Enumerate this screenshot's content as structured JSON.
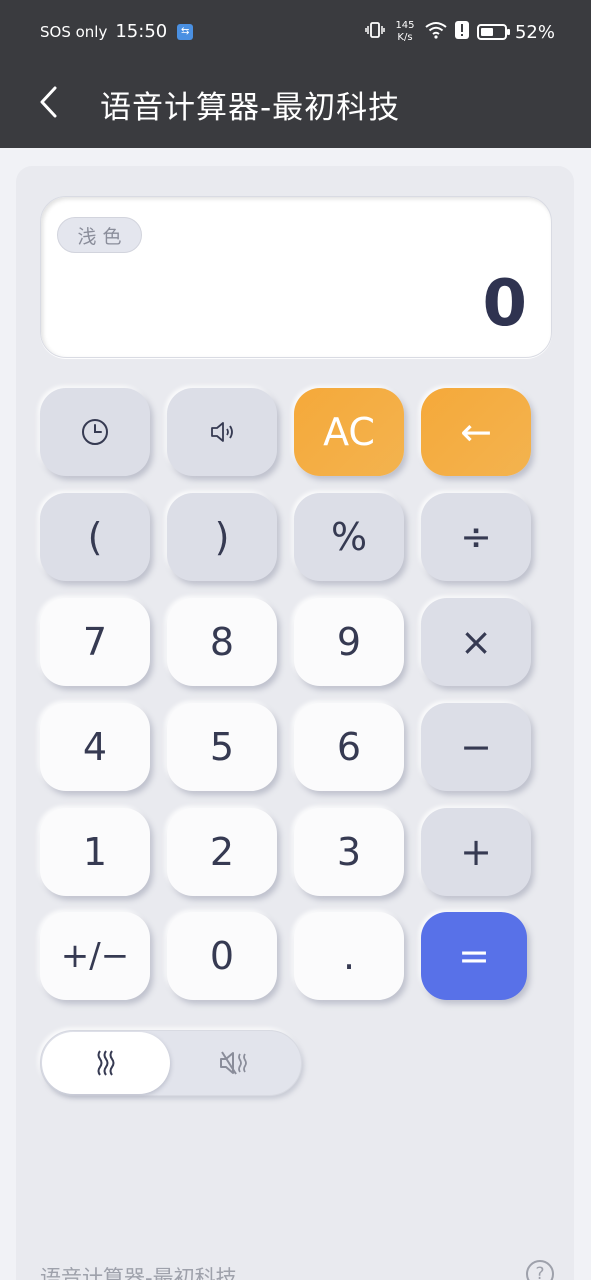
{
  "status_bar": {
    "carrier": "SOS only",
    "time": "15:50",
    "speed_value": "145",
    "speed_unit": "K/s",
    "battery": "52%",
    "battery_level": 0.52
  },
  "header": {
    "title": "语音计算器-最初科技",
    "back_icon": "chevron-left-icon"
  },
  "display": {
    "theme_label": "浅色",
    "value": "0"
  },
  "keys": [
    {
      "name": "history-key",
      "label": "",
      "icon": "clock-icon",
      "style": "gray"
    },
    {
      "name": "speaker-key",
      "label": "",
      "icon": "speaker-icon",
      "style": "gray"
    },
    {
      "name": "all-clear-key",
      "label": "AC",
      "style": "orange"
    },
    {
      "name": "backspace-key",
      "label": "←",
      "style": "orange"
    },
    {
      "name": "open-paren-key",
      "label": "(",
      "style": "gray"
    },
    {
      "name": "close-paren-key",
      "label": ")",
      "style": "gray"
    },
    {
      "name": "percent-key",
      "label": "%",
      "style": "gray"
    },
    {
      "name": "divide-key",
      "label": "÷",
      "style": "gray"
    },
    {
      "name": "digit-7-key",
      "label": "7",
      "style": "white"
    },
    {
      "name": "digit-8-key",
      "label": "8",
      "style": "white"
    },
    {
      "name": "digit-9-key",
      "label": "9",
      "style": "white"
    },
    {
      "name": "multiply-key",
      "label": "×",
      "style": "gray"
    },
    {
      "name": "digit-4-key",
      "label": "4",
      "style": "white"
    },
    {
      "name": "digit-5-key",
      "label": "5",
      "style": "white"
    },
    {
      "name": "digit-6-key",
      "label": "6",
      "style": "white"
    },
    {
      "name": "minus-key",
      "label": "−",
      "style": "gray"
    },
    {
      "name": "digit-1-key",
      "label": "1",
      "style": "white"
    },
    {
      "name": "digit-2-key",
      "label": "2",
      "style": "white"
    },
    {
      "name": "digit-3-key",
      "label": "3",
      "style": "white"
    },
    {
      "name": "plus-key",
      "label": "+",
      "style": "gray"
    },
    {
      "name": "sign-toggle-key",
      "label": "+/−",
      "style": "white"
    },
    {
      "name": "digit-0-key",
      "label": "0",
      "style": "white"
    },
    {
      "name": "decimal-key",
      "label": ".",
      "style": "white"
    },
    {
      "name": "equals-key",
      "label": "=",
      "style": "blue"
    }
  ],
  "toggle": {
    "active": "vibration-icon",
    "inactive": "mute-vibration-icon"
  },
  "footer": {
    "label": "语音计算器-最初科技",
    "help_icon": "help-icon"
  }
}
